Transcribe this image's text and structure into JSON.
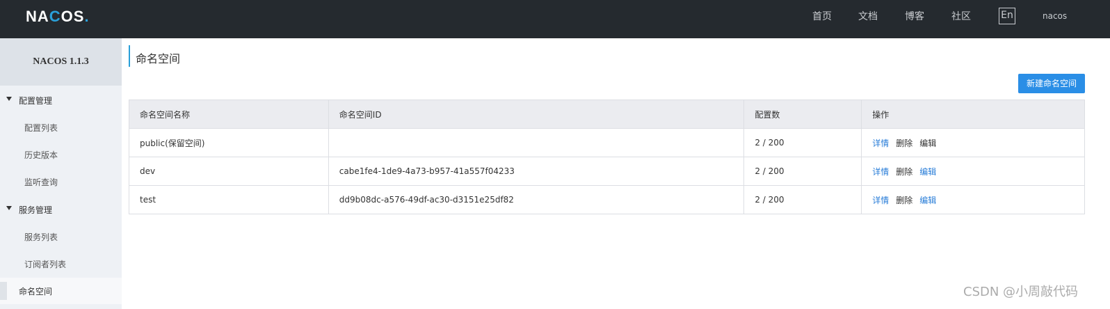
{
  "header": {
    "logo_pre": "NA",
    "logo_o": "C",
    "logo_post": "OS",
    "logo_dot": ".",
    "nav": [
      "首页",
      "文档",
      "博客",
      "社区"
    ],
    "lang": "En",
    "user": "nacos"
  },
  "sidebar": {
    "brand": "NACOS 1.1.3",
    "groups": [
      {
        "label": "配置管理",
        "items": [
          "配置列表",
          "历史版本",
          "监听查询"
        ]
      },
      {
        "label": "服务管理",
        "items": [
          "服务列表",
          "订阅者列表"
        ]
      }
    ],
    "active_item": "命名空间"
  },
  "main": {
    "title": "命名空间",
    "new_button": "新建命名空间",
    "columns": [
      "命名空间名称",
      "命名空间ID",
      "配置数",
      "操作"
    ],
    "rows": [
      {
        "name": "public(保留空间)",
        "id": "",
        "count": "2 / 200",
        "ops": [
          "详情",
          "删除",
          "编辑"
        ]
      },
      {
        "name": "dev",
        "id": "cabe1fe4-1de9-4a73-b957-41a557f04233",
        "count": "2 / 200",
        "ops": [
          "详情",
          "删除",
          "编辑"
        ]
      },
      {
        "name": "test",
        "id": "dd9b08dc-a576-49df-ac30-d3151e25df82",
        "count": "2 / 200",
        "ops": [
          "详情",
          "删除",
          "编辑"
        ]
      }
    ]
  },
  "watermark": "CSDN @小周敲代码"
}
